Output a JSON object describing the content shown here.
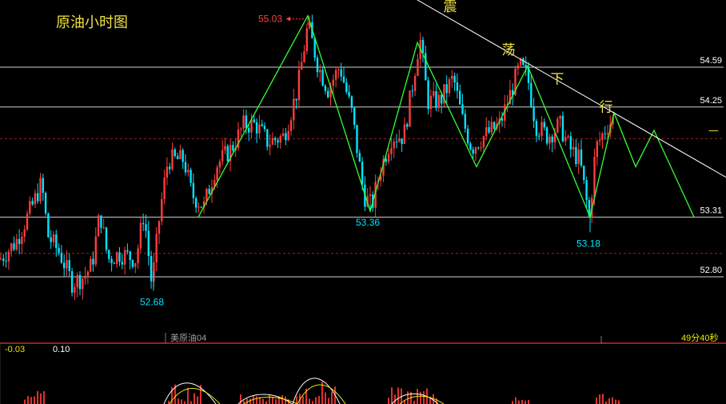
{
  "title": "原油小时图",
  "instrument": "美原油04",
  "timer": "49分40秒",
  "sub_panel": {
    "readout_a": "-0.03",
    "readout_b": "0.10"
  },
  "colors": {
    "up": "#ff3c3c",
    "down": "#00e5ff",
    "zigzag": "#33ff33",
    "trend": "#ffffff",
    "text_yellow": "#f0e040",
    "label_cyan": "#00e5ff",
    "label_red": "#ff4040",
    "level_line": "#d0d0d0",
    "dashed": "#a02020"
  },
  "chart_data": {
    "type": "candlestick",
    "ylim": [
      51.7,
      55.3
    ],
    "price_levels": [
      {
        "value": 54.59,
        "label": "54.59"
      },
      {
        "value": 54.25,
        "label": "54.25"
      },
      {
        "value": 53.31,
        "label": "53.31"
      },
      {
        "value": 52.8,
        "label": "52.80"
      }
    ],
    "dashed_levels": [
      53.98,
      53.0
    ],
    "extremes": [
      {
        "i": 38,
        "value": 55.03,
        "label": "55.03",
        "side": "top",
        "arrow": true
      },
      {
        "i": 91,
        "value": 53.36,
        "label": "53.36",
        "side": "bottom"
      },
      {
        "i": 29,
        "value": 52.68,
        "label": "52.68",
        "side": "bottom"
      },
      {
        "i": 214,
        "value": 53.18,
        "label": "53.18",
        "side": "bottom"
      }
    ],
    "zigzag": [
      [
        248,
        53.31
      ],
      [
        385,
        55.03
      ],
      [
        463,
        53.36
      ],
      [
        522,
        54.8
      ],
      [
        596,
        53.74
      ],
      [
        660,
        54.6
      ],
      [
        738,
        53.31
      ],
      [
        768,
        54.2
      ],
      [
        795,
        53.74
      ],
      [
        818,
        54.05
      ],
      [
        868,
        53.31
      ]
    ],
    "trendline": {
      "from": [
        462,
        55.4
      ],
      "to": [
        908,
        53.65
      ]
    },
    "annotations": [
      {
        "text": "震",
        "x": 563,
        "value": 55.07
      },
      {
        "text": "荡",
        "x": 636,
        "value": 54.7
      },
      {
        "text": "下",
        "x": 697,
        "value": 54.45
      },
      {
        "text": "行",
        "x": 758,
        "value": 54.21
      }
    ],
    "right_marker": {
      "text": "—",
      "value": 54.05
    },
    "price_path": [
      [
        0,
        52.95
      ],
      [
        20,
        53.1
      ],
      [
        40,
        53.4
      ],
      [
        52,
        53.6
      ],
      [
        60,
        53.15
      ],
      [
        75,
        53.0
      ],
      [
        90,
        52.75
      ],
      [
        105,
        52.8
      ],
      [
        115,
        52.9
      ],
      [
        125,
        53.35
      ],
      [
        135,
        52.95
      ],
      [
        150,
        53.0
      ],
      [
        170,
        52.95
      ],
      [
        180,
        53.35
      ],
      [
        190,
        52.72
      ],
      [
        200,
        53.35
      ],
      [
        210,
        53.8
      ],
      [
        230,
        53.8
      ],
      [
        240,
        53.5
      ],
      [
        255,
        53.4
      ],
      [
        270,
        53.75
      ],
      [
        290,
        53.9
      ],
      [
        305,
        54.1
      ],
      [
        320,
        54.1
      ],
      [
        335,
        53.95
      ],
      [
        355,
        54.0
      ],
      [
        372,
        54.4
      ],
      [
        385,
        54.95
      ],
      [
        398,
        54.6
      ],
      [
        410,
        54.4
      ],
      [
        425,
        54.6
      ],
      [
        440,
        54.2
      ],
      [
        455,
        53.5
      ],
      [
        465,
        53.4
      ],
      [
        475,
        53.7
      ],
      [
        490,
        54.0
      ],
      [
        505,
        54.0
      ],
      [
        515,
        54.4
      ],
      [
        525,
        54.85
      ],
      [
        535,
        54.3
      ],
      [
        550,
        54.3
      ],
      [
        567,
        54.5
      ],
      [
        578,
        54.15
      ],
      [
        590,
        53.9
      ],
      [
        605,
        54.0
      ],
      [
        625,
        54.1
      ],
      [
        640,
        54.4
      ],
      [
        650,
        54.6
      ],
      [
        660,
        54.5
      ],
      [
        670,
        54.1
      ],
      [
        685,
        54.0
      ],
      [
        700,
        54.1
      ],
      [
        712,
        53.9
      ],
      [
        725,
        53.8
      ],
      [
        737,
        53.3
      ],
      [
        745,
        53.9
      ],
      [
        760,
        54.1
      ],
      [
        768,
        54.15
      ]
    ]
  }
}
